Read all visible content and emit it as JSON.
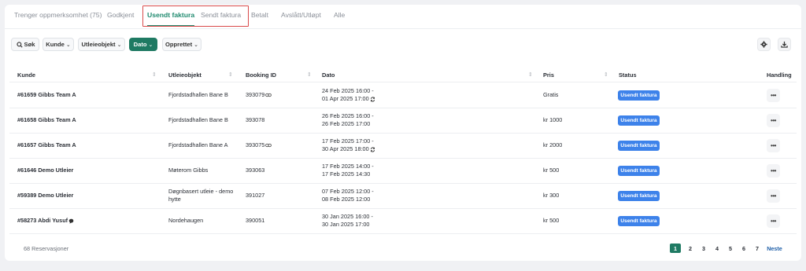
{
  "tabs": [
    {
      "label": "Trenger oppmerksomhet (75)"
    },
    {
      "label": "Godkjent"
    },
    {
      "label": "Usendt faktura"
    },
    {
      "label": "Sendt faktura"
    },
    {
      "label": "Betalt"
    },
    {
      "label": "Avslått/Utløpt"
    },
    {
      "label": "Alle"
    }
  ],
  "active_tab": "Usendt faktura",
  "toolbar": {
    "search_label": "Søk",
    "filters": [
      "Kunde",
      "Utleieobjekt",
      "Dato",
      "Opprettet"
    ],
    "active_filter": "Dato"
  },
  "columns": [
    "Kunde",
    "Utleieobjekt",
    "Booking ID",
    "Dato",
    "Pris",
    "Status",
    "Handling"
  ],
  "rows": [
    {
      "kunde": "#61659 Gibbs Team A",
      "objekt": "Fjordstadhallen Bane B",
      "objekt2": "",
      "booking": "393079",
      "link": true,
      "dato1": "24 Feb 2025 16:00 -",
      "dato2": "01 Apr 2025 17:00",
      "repeat": true,
      "pris": "Gratis",
      "status": "Usendt faktura",
      "comment": false
    },
    {
      "kunde": "#61658 Gibbs Team A",
      "objekt": "Fjordstadhallen Bane B",
      "objekt2": "",
      "booking": "393078",
      "link": false,
      "dato1": "26 Feb 2025 16:00 -",
      "dato2": "26 Feb 2025 17:00",
      "repeat": false,
      "pris": "kr 1000",
      "status": "Usendt faktura",
      "comment": false
    },
    {
      "kunde": "#61657 Gibbs Team A",
      "objekt": "Fjordstadhallen Bane A",
      "objekt2": "",
      "booking": "393075",
      "link": true,
      "dato1": "17 Feb 2025 17:00 -",
      "dato2": "30 Apr 2025 18:00",
      "repeat": true,
      "pris": "kr 2000",
      "status": "Usendt faktura",
      "comment": false
    },
    {
      "kunde": "#61646 Demo Utleier",
      "objekt": "Møterom Gibbs",
      "objekt2": "",
      "booking": "393063",
      "link": false,
      "dato1": "17 Feb 2025 14:00 -",
      "dato2": "17 Feb 2025 14:30",
      "repeat": false,
      "pris": "kr 500",
      "status": "Usendt faktura",
      "comment": false
    },
    {
      "kunde": "#59389 Demo Utleier",
      "objekt": "Døgnbasert utleie - demo",
      "objekt2": "hytte",
      "booking": "391027",
      "link": false,
      "dato1": "07 Feb 2025 12:00 -",
      "dato2": "08 Feb 2025 12:00",
      "repeat": false,
      "pris": "kr 300",
      "status": "Usendt faktura",
      "comment": false
    },
    {
      "kunde": "#58273 Abdi Yusuf",
      "objekt": "Nordehaugen",
      "objekt2": "",
      "booking": "390051",
      "link": false,
      "dato1": "30 Jan 2025 16:00 -",
      "dato2": "30 Jan 2025 17:00",
      "repeat": false,
      "pris": "kr 500",
      "status": "Usendt faktura",
      "comment": true
    }
  ],
  "footer": {
    "count": "68 Reservasjoner",
    "pages": [
      "1",
      "2",
      "3",
      "4",
      "5",
      "6",
      "7"
    ],
    "current_page": "1",
    "next_label": "Neste"
  },
  "colors": {
    "accent": "#1f7a63",
    "badge": "#3d82ea",
    "highlight": "#d94a4a"
  }
}
